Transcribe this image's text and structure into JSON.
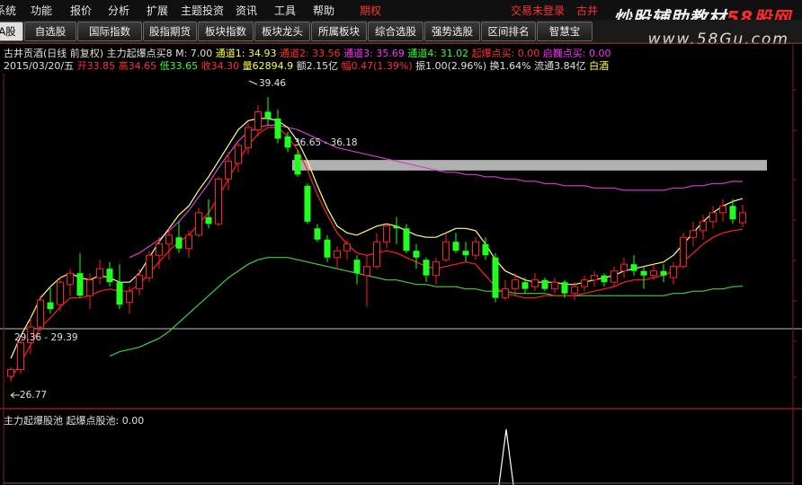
{
  "menu": {
    "items": [
      "系统",
      "功能",
      "报价",
      "分析",
      "扩展",
      "主题投资",
      "资讯",
      "工具",
      "帮助"
    ],
    "highlight": "期权",
    "status": "交易未登录",
    "stock_short": "古井"
  },
  "watermark": {
    "text_a": "炒股辅助教材",
    "text_b": "58股网",
    "url": "www.58Gu.com"
  },
  "toolbar": {
    "buttons": [
      "A股",
      "自选股",
      "国际指数",
      "股指期货",
      "板块指数",
      "板块龙头",
      "所属板块",
      "综合选股",
      "强势选股",
      "区间排名",
      "智慧宝"
    ]
  },
  "header": {
    "line1": {
      "stock": "古井贡酒(日线 前复权)",
      "indicator": "主力起爆点买8",
      "m": "M: 7.00",
      "ch1": "通道1: 34.93",
      "ch2": "通道2: 33.56",
      "ch3": "通道3: 35.69",
      "ch4": "通道4: 31.02",
      "bomb": "起爆点买: 0.00",
      "wealth": "启巍点买: 0.00"
    },
    "line2": {
      "date": "2015/03/20/五",
      "open": "开33.85",
      "high": "高34.65",
      "low": "低33.65",
      "close": "收34.30",
      "vol": "量62894.9",
      "amount": "额2.15亿",
      "change": "幅0.47(1.39%)",
      "swing": "振1.00(2.96%)",
      "turnover": "换1.64%",
      "float": "流通3.84亿",
      "sector": "白酒"
    }
  },
  "annotations": {
    "high": "39.46",
    "band": "36.65 - 36.18",
    "support": "29.36 - 29.39",
    "low": "26.77"
  },
  "sub_panel": {
    "title": "主力起爆股池",
    "value": "起爆点股池: 0.00"
  },
  "colors": {
    "up": "#ff2020",
    "down": "#20ff20",
    "ch_yellow": "#ffff80",
    "ch_purple": "#d040d0",
    "ch_green": "#40d040",
    "band": "#b0b0b0"
  },
  "chart_data": {
    "type": "candlestick",
    "price_range": [
      26.0,
      40.5
    ],
    "candles": [
      [
        27.0,
        27.4,
        26.77,
        27.3
      ],
      [
        27.3,
        28.6,
        27.1,
        28.5
      ],
      [
        28.5,
        29.6,
        28.0,
        29.2
      ],
      [
        29.2,
        30.6,
        29.0,
        30.4
      ],
      [
        30.3,
        31.0,
        29.8,
        30.0
      ],
      [
        30.2,
        31.4,
        29.9,
        31.2
      ],
      [
        31.1,
        31.8,
        30.6,
        31.6
      ],
      [
        31.6,
        32.5,
        30.5,
        30.6
      ],
      [
        30.6,
        31.6,
        30.0,
        31.3
      ],
      [
        31.4,
        32.2,
        31.1,
        31.8
      ],
      [
        31.8,
        32.1,
        31.0,
        31.2
      ],
      [
        31.2,
        32.0,
        30.0,
        30.2
      ],
      [
        30.3,
        31.0,
        29.8,
        30.8
      ],
      [
        30.9,
        31.8,
        30.6,
        31.5
      ],
      [
        31.4,
        32.6,
        31.2,
        32.4
      ],
      [
        32.4,
        33.2,
        31.8,
        32.9
      ],
      [
        32.9,
        33.6,
        32.2,
        33.3
      ],
      [
        33.2,
        33.9,
        32.5,
        32.7
      ],
      [
        32.7,
        33.5,
        32.3,
        33.3
      ],
      [
        33.3,
        34.5,
        33.2,
        34.3
      ],
      [
        34.1,
        34.9,
        33.6,
        33.8
      ],
      [
        33.8,
        35.9,
        33.7,
        35.8
      ],
      [
        35.8,
        37.0,
        35.3,
        36.6
      ],
      [
        36.5,
        37.5,
        36.1,
        37.3
      ],
      [
        37.2,
        38.3,
        36.9,
        38.1
      ],
      [
        38.0,
        39.1,
        37.7,
        38.8
      ],
      [
        38.8,
        39.46,
        38.2,
        38.5
      ],
      [
        38.5,
        38.9,
        37.4,
        37.6
      ],
      [
        37.7,
        37.9,
        37.0,
        37.2
      ],
      [
        36.9,
        37.1,
        35.9,
        36.0
      ],
      [
        35.5,
        35.6,
        33.8,
        33.9
      ],
      [
        33.6,
        33.8,
        33.0,
        33.1
      ],
      [
        33.1,
        33.3,
        32.1,
        32.3
      ],
      [
        32.3,
        32.8,
        31.8,
        32.6
      ],
      [
        32.6,
        33.1,
        32.2,
        32.9
      ],
      [
        32.2,
        32.4,
        31.1,
        31.6
      ],
      [
        31.5,
        32.4,
        30.1,
        31.9
      ],
      [
        31.9,
        33.4,
        31.8,
        33.0
      ],
      [
        33.0,
        33.8,
        32.7,
        33.7
      ],
      [
        33.7,
        34.1,
        32.9,
        33.6
      ],
      [
        33.6,
        33.8,
        32.5,
        32.6
      ],
      [
        32.6,
        32.9,
        31.8,
        32.3
      ],
      [
        32.2,
        32.3,
        31.2,
        31.5
      ],
      [
        31.5,
        32.3,
        31.1,
        32.1
      ],
      [
        32.2,
        33.4,
        32.1,
        33.0
      ],
      [
        33.0,
        33.4,
        32.5,
        32.6
      ],
      [
        32.6,
        33.0,
        32.1,
        32.4
      ],
      [
        32.4,
        33.2,
        32.2,
        33.0
      ],
      [
        32.9,
        33.2,
        32.2,
        32.4
      ],
      [
        32.3,
        32.5,
        30.3,
        30.5
      ],
      [
        30.5,
        31.3,
        30.4,
        30.9
      ],
      [
        30.9,
        31.6,
        30.6,
        31.3
      ],
      [
        31.2,
        31.4,
        30.7,
        30.9
      ],
      [
        31.0,
        31.6,
        30.8,
        31.3
      ],
      [
        31.3,
        31.4,
        30.8,
        30.9
      ],
      [
        30.9,
        31.4,
        30.7,
        31.2
      ],
      [
        31.2,
        31.3,
        30.5,
        30.7
      ],
      [
        30.7,
        31.2,
        30.4,
        31.0
      ],
      [
        31.0,
        31.5,
        30.8,
        31.3
      ],
      [
        31.3,
        31.7,
        31.0,
        31.5
      ],
      [
        31.5,
        31.6,
        31.0,
        31.2
      ],
      [
        31.2,
        31.9,
        31.0,
        31.7
      ],
      [
        31.7,
        32.3,
        31.4,
        32.0
      ],
      [
        32.0,
        32.4,
        31.5,
        31.7
      ],
      [
        31.7,
        31.9,
        30.9,
        31.5
      ],
      [
        31.5,
        32.0,
        31.3,
        31.7
      ],
      [
        31.7,
        32.0,
        31.2,
        31.5
      ],
      [
        31.4,
        32.1,
        31.1,
        31.9
      ],
      [
        31.9,
        33.4,
        31.8,
        33.2
      ],
      [
        33.2,
        33.9,
        32.8,
        33.5
      ],
      [
        33.5,
        34.2,
        33.1,
        33.9
      ],
      [
        33.9,
        34.6,
        33.6,
        34.3
      ],
      [
        34.3,
        34.9,
        33.9,
        34.6
      ],
      [
        34.6,
        34.9,
        33.8,
        34.0
      ],
      [
        33.85,
        34.65,
        33.65,
        34.3
      ]
    ],
    "channels": {
      "yellow": [
        27.8,
        28.8,
        29.6,
        30.5,
        31.0,
        31.4,
        31.6,
        31.4,
        31.3,
        31.5,
        31.4,
        31.2,
        31.2,
        31.6,
        32.3,
        33.0,
        33.6,
        34.2,
        34.6,
        35.3,
        35.9,
        36.6,
        37.3,
        38.0,
        38.4,
        38.5,
        38.5,
        38.4,
        38.1,
        37.5,
        36.6,
        35.5,
        34.5,
        33.7,
        33.4,
        33.3,
        33.5,
        33.7,
        33.8,
        33.7,
        33.5,
        33.3,
        33.2,
        33.2,
        33.4,
        33.6,
        33.6,
        33.5,
        32.9,
        32.2,
        31.7,
        31.5,
        31.3,
        31.2,
        31.2,
        31.2,
        31.1,
        31.1,
        31.2,
        31.3,
        31.4,
        31.5,
        31.7,
        31.8,
        31.9,
        32.0,
        32.1,
        32.4,
        32.9,
        33.4,
        33.9,
        34.3,
        34.6,
        34.8,
        34.93
      ],
      "red": [
        26.9,
        27.6,
        28.4,
        29.2,
        29.6,
        30.1,
        30.5,
        30.5,
        30.6,
        30.8,
        30.9,
        30.8,
        30.8,
        31.1,
        31.6,
        32.1,
        32.6,
        33.0,
        33.3,
        33.8,
        34.3,
        35.0,
        35.8,
        36.6,
        37.3,
        37.8,
        38.1,
        38.1,
        37.7,
        37.1,
        36.2,
        35.1,
        34.2,
        33.4,
        32.9,
        32.5,
        32.4,
        32.5,
        32.6,
        32.5,
        32.3,
        32.1,
        31.9,
        31.8,
        31.9,
        32.0,
        32.1,
        32.0,
        31.5,
        31.0,
        30.7,
        30.6,
        30.5,
        30.5,
        30.6,
        30.6,
        30.6,
        30.6,
        30.7,
        30.8,
        30.9,
        31.0,
        31.2,
        31.3,
        31.3,
        31.4,
        31.5,
        31.7,
        32.1,
        32.5,
        32.9,
        33.2,
        33.4,
        33.5,
        33.56
      ],
      "purple": [
        null,
        null,
        null,
        null,
        null,
        null,
        null,
        null,
        null,
        null,
        null,
        null,
        32.3,
        32.5,
        32.8,
        33.1,
        33.5,
        33.9,
        34.4,
        35.0,
        35.6,
        36.3,
        36.9,
        37.5,
        37.9,
        38.1,
        38.2,
        38.2,
        38.1,
        38.0,
        37.8,
        37.6,
        37.4,
        37.2,
        37.1,
        37.0,
        36.9,
        36.8,
        36.7,
        36.6,
        36.5,
        36.4,
        36.3,
        36.2,
        36.1,
        36.1,
        36.0,
        36.0,
        35.9,
        35.9,
        35.8,
        35.8,
        35.7,
        35.7,
        35.6,
        35.6,
        35.5,
        35.5,
        35.5,
        35.4,
        35.4,
        35.4,
        35.3,
        35.3,
        35.3,
        35.3,
        35.3,
        35.4,
        35.4,
        35.5,
        35.5,
        35.6,
        35.6,
        35.7,
        35.69
      ],
      "green": [
        null,
        null,
        null,
        null,
        null,
        null,
        null,
        null,
        null,
        null,
        27.9,
        28.1,
        28.2,
        28.3,
        28.5,
        28.7,
        29.0,
        29.4,
        29.8,
        30.2,
        30.6,
        31.0,
        31.4,
        31.7,
        32.0,
        32.2,
        32.3,
        32.3,
        32.3,
        32.2,
        32.1,
        32.0,
        31.9,
        31.8,
        31.7,
        31.6,
        31.5,
        31.4,
        31.3,
        31.3,
        31.2,
        31.1,
        31.1,
        31.0,
        31.0,
        31.0,
        30.9,
        30.9,
        30.8,
        30.8,
        30.8,
        30.7,
        30.7,
        30.7,
        30.7,
        30.6,
        30.6,
        30.6,
        30.6,
        30.6,
        30.6,
        30.6,
        30.6,
        30.6,
        30.6,
        30.6,
        30.6,
        30.7,
        30.7,
        30.8,
        30.8,
        30.9,
        30.9,
        31.0,
        31.02
      ]
    }
  }
}
